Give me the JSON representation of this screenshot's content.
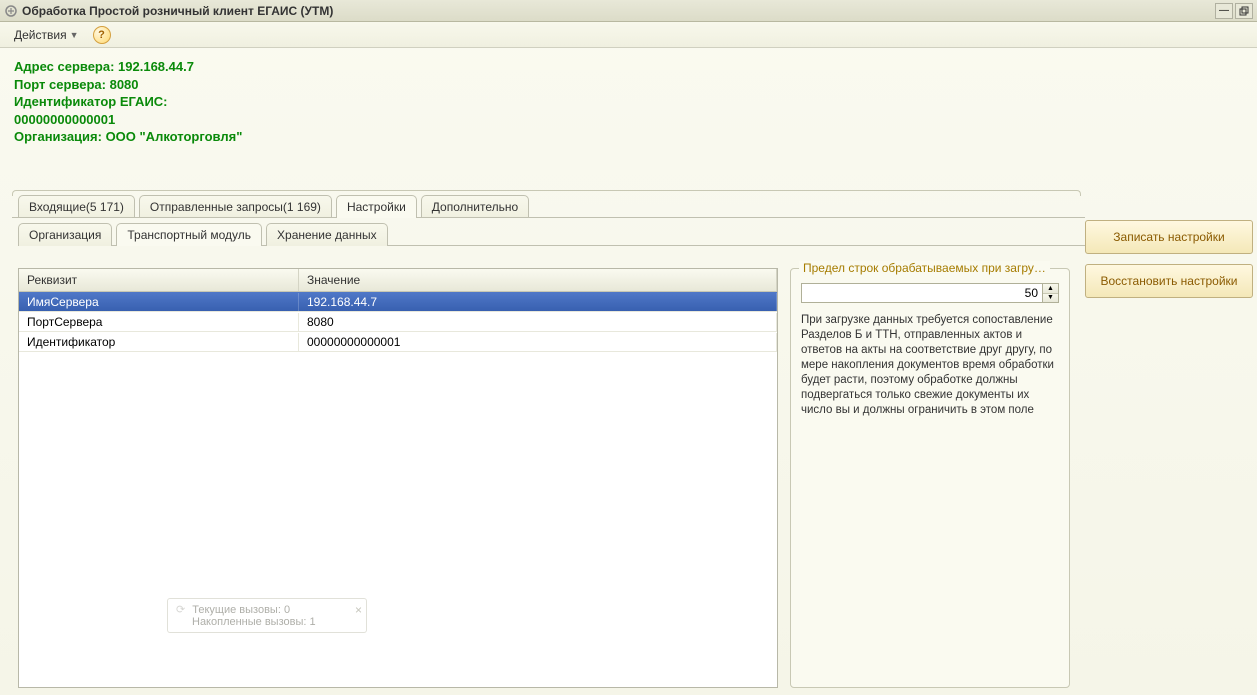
{
  "window": {
    "title": "Обработка  Простой розничный клиент ЕГАИС (УТМ)"
  },
  "toolbar": {
    "actions_label": "Действия"
  },
  "info": {
    "line1": "Адрес сервера: 192.168.44.7",
    "line2": "Порт сервера: 8080",
    "line3": "Идентификатор ЕГАИС:",
    "line4": "00000000000001",
    "line5": "Организация: ООО \"Алкоторговля\""
  },
  "tabs_outer": [
    {
      "label": "Входящие(5 171)"
    },
    {
      "label": "Отправленные запросы(1 169)"
    },
    {
      "label": "Настройки"
    },
    {
      "label": "Дополнительно"
    }
  ],
  "tabs_inner": [
    {
      "label": "Организация"
    },
    {
      "label": "Транспортный модуль"
    },
    {
      "label": "Хранение данных"
    }
  ],
  "table": {
    "headers": {
      "col1": "Реквизит",
      "col2": "Значение"
    },
    "rows": [
      {
        "name": "ИмяСервера",
        "value": "192.168.44.7"
      },
      {
        "name": "ПортСервера",
        "value": "8080"
      },
      {
        "name": "Идентификатор",
        "value": "00000000000001"
      }
    ]
  },
  "limit_box": {
    "legend": "Предел строк обрабатываемых при загру…",
    "value": "50",
    "description": "При загрузке данных требуется сопоставление Разделов Б и ТТН, отправленных актов и ответов на акты  на соответствие друг другу, по мере накопления документов время обработки будет расти, поэтому обработке должны подвергаться только свежие документы их число вы и должны ограничить в этом поле"
  },
  "buttons": {
    "save": "Записать настройки",
    "restore": "Восстановить настройки"
  },
  "tooltip": {
    "line1": "Текущие вызовы: 0",
    "line2": "Накопленные вызовы: 1"
  }
}
